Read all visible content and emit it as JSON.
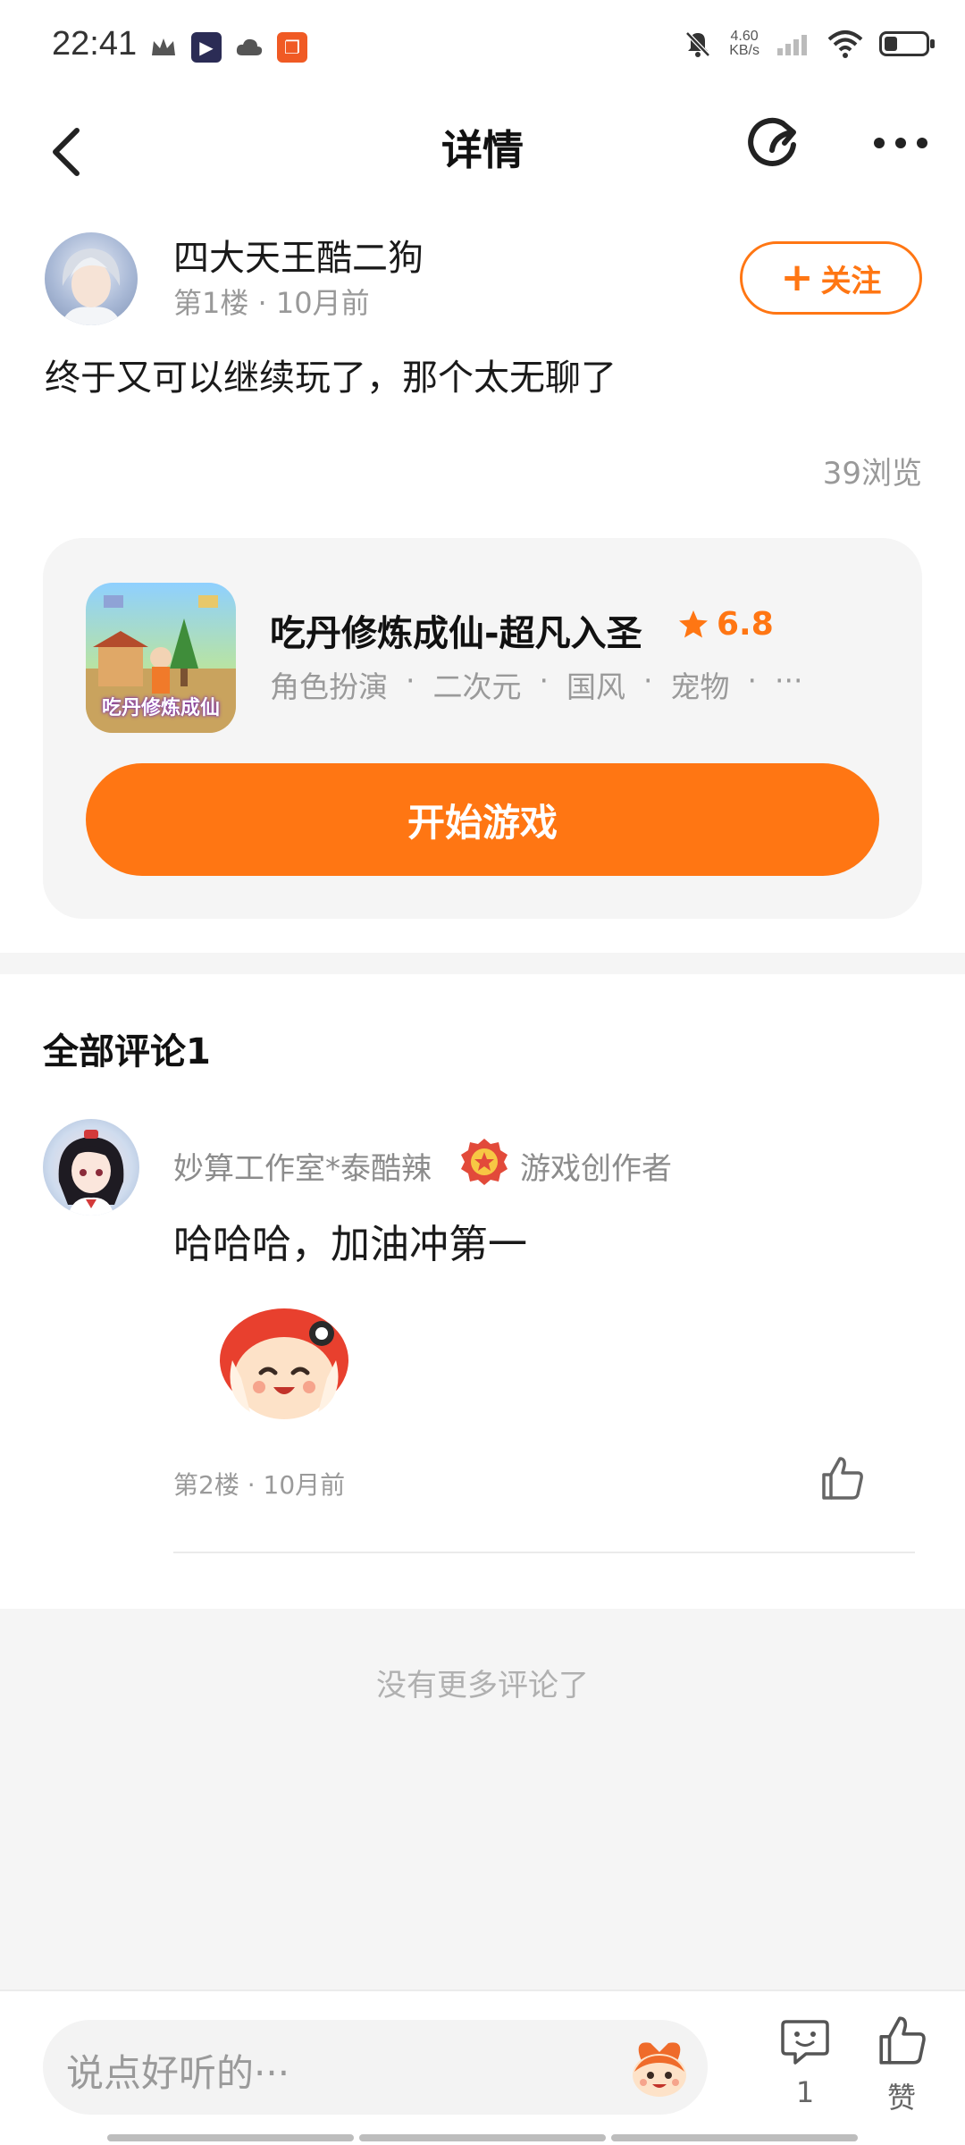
{
  "status_bar": {
    "time": "22:41",
    "network_speed_value": "4.60",
    "network_speed_unit": "KB/s",
    "icons": [
      "crown-icon",
      "app-icon",
      "cloud-icon",
      "app-icon",
      "mute-bell-icon",
      "signal-icon",
      "wifi-icon",
      "battery-icon"
    ]
  },
  "nav": {
    "title": "详情",
    "icons": [
      "back-arrow-icon",
      "share-icon",
      "more-icon"
    ]
  },
  "post": {
    "author": "四大天王酷二狗",
    "meta": "第1楼 · 10月前",
    "follow_label": "关注",
    "content": "终于又可以继续玩了，那个太无聊了",
    "views": "39浏览"
  },
  "game": {
    "icon_caption": "吃丹修炼成仙",
    "title": "吃丹修炼成仙-超凡入圣",
    "rating": "6.8",
    "tags": [
      "角色扮演",
      "二次元",
      "国风",
      "宠物"
    ],
    "tag_separator": "·",
    "tags_more": "···",
    "play_label": "开始游戏"
  },
  "comments": {
    "header": "全部评论1",
    "items": [
      {
        "user": "妙算工作室*泰酷辣",
        "badge": "游戏创作者",
        "text": "哈哈哈，加油冲第一",
        "meta": "第2楼 · 10月前"
      }
    ],
    "no_more": "没有更多评论了"
  },
  "bottom_bar": {
    "input_placeholder": "说点好听的···",
    "comment_count": "1",
    "like_label": "赞"
  },
  "colors": {
    "accent": "#ff7613",
    "background": "#f5f5f5",
    "muted_text": "#999999"
  }
}
